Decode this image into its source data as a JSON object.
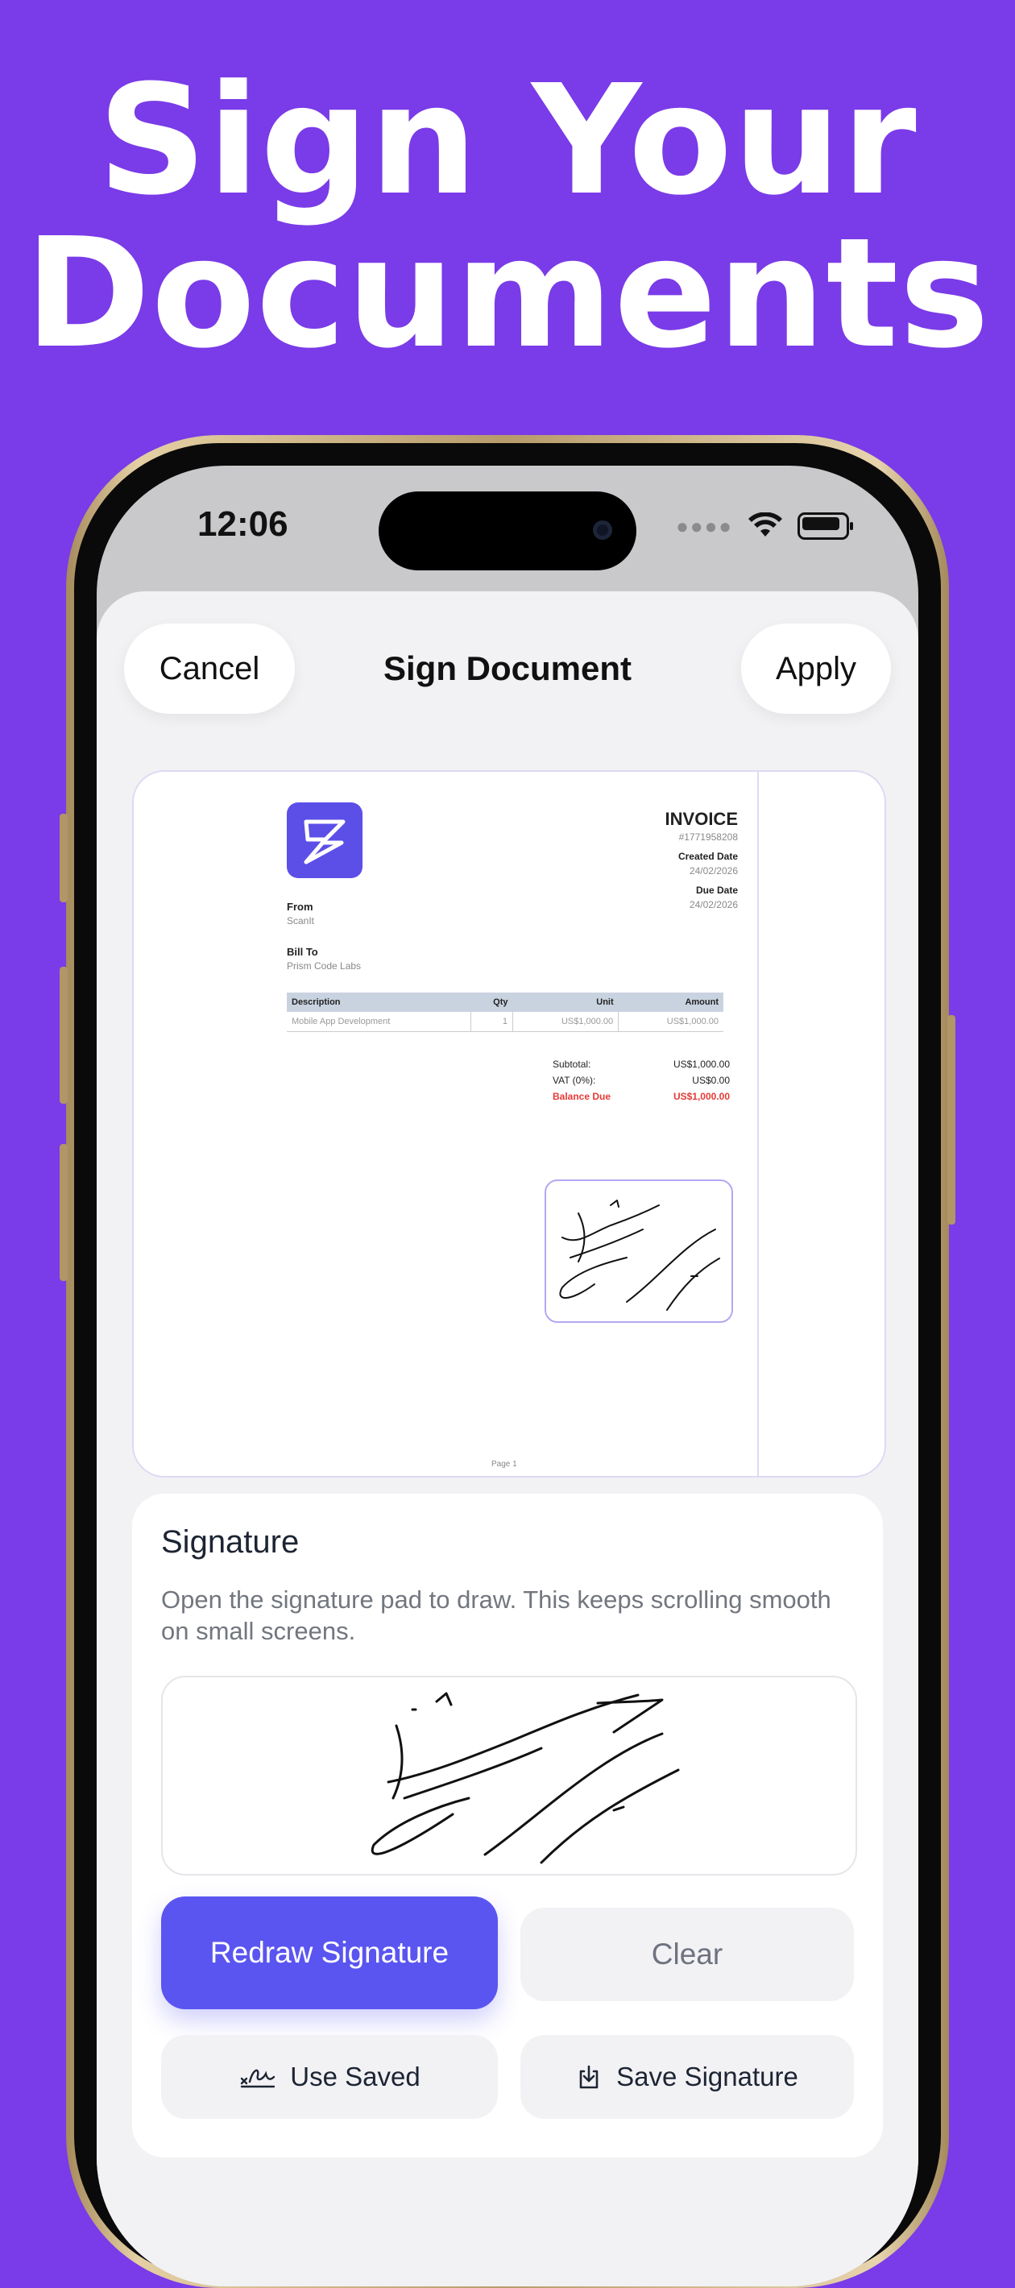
{
  "headline": {
    "line1": "Sign Your",
    "line2": "Documents"
  },
  "status_bar": {
    "time": "12:06"
  },
  "nav": {
    "cancel_label": "Cancel",
    "title": "Sign Document",
    "apply_label": "Apply"
  },
  "document": {
    "invoice_title": "INVOICE",
    "invoice_number": "#1771958208",
    "created_label": "Created Date",
    "created_value": "24/02/2026",
    "due_label": "Due Date",
    "due_value": "24/02/2026",
    "from_label": "From",
    "from_value": "ScanIt",
    "bill_label": "Bill To",
    "bill_value": "Prism Code Labs",
    "table_headers": [
      "Description",
      "Qty",
      "Unit",
      "Amount"
    ],
    "table_rows": [
      [
        "Mobile App Development",
        "1",
        "US$1,000.00",
        "US$1,000.00"
      ]
    ],
    "subtotal_label": "Subtotal:",
    "subtotal_value": "US$1,000.00",
    "vat_label": "VAT (0%):",
    "vat_value": "US$0.00",
    "balance_label": "Balance Due",
    "balance_value": "US$1,000.00",
    "page_label": "Page 1"
  },
  "signature": {
    "title": "Signature",
    "description": "Open the signature pad to draw. This keeps scrolling smooth on small screens.",
    "redraw_label": "Redraw Signature",
    "clear_label": "Clear",
    "use_saved_label": "Use Saved",
    "save_label": "Save Signature"
  },
  "colors": {
    "background": "#7a3be8",
    "accent": "#5a55f0",
    "balance_due": "#e53935"
  }
}
